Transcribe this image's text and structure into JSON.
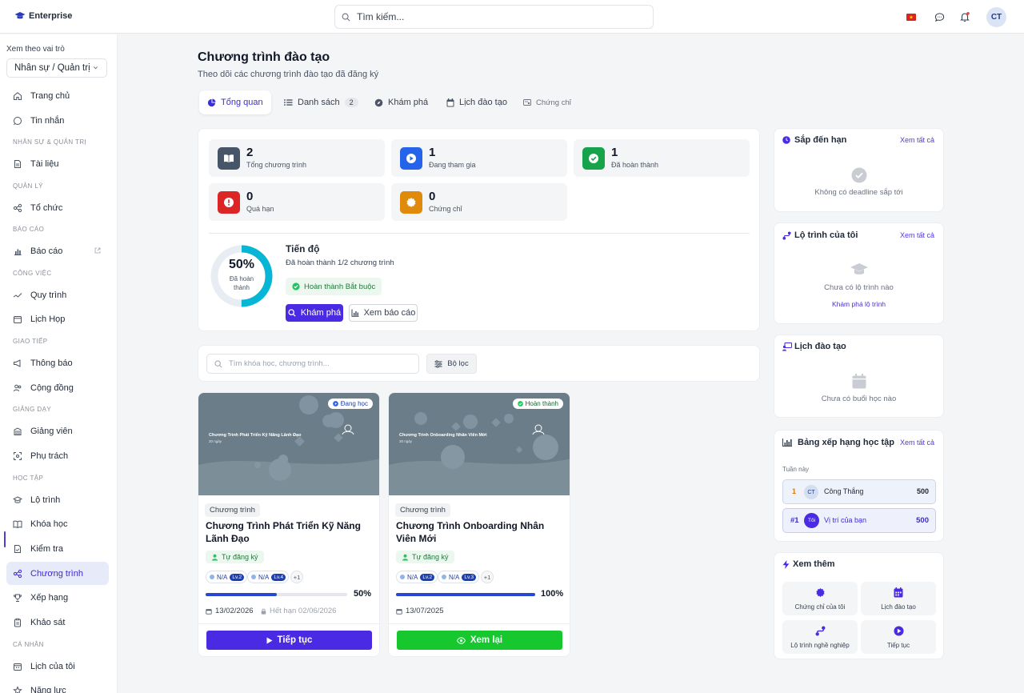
{
  "brand": {
    "name": "Enterprise"
  },
  "header": {
    "search_placeholder": "Tìm kiếm...",
    "avatar_initials": "CT"
  },
  "sidebar": {
    "role_label": "Xem theo vai trò",
    "role_value": "Nhân sự / Quản trị",
    "items": [
      {
        "label": "Trang chủ"
      },
      {
        "label": "Tin nhắn"
      },
      {
        "section": "NHÂN SỰ & QUẢN TRỊ"
      },
      {
        "label": "Tài liệu"
      },
      {
        "section": "QUẢN LÝ"
      },
      {
        "label": "Tổ chức"
      },
      {
        "section": "BÁO CÁO"
      },
      {
        "label": "Báo cáo"
      },
      {
        "section": "CÔNG VIỆC"
      },
      {
        "label": "Quy trình"
      },
      {
        "label": "Lịch Họp"
      },
      {
        "section": "GIAO TIẾP"
      },
      {
        "label": "Thông báo"
      },
      {
        "label": "Cộng đồng"
      },
      {
        "section": "GIẢNG DẠY"
      },
      {
        "label": "Giảng viên"
      },
      {
        "label": "Phụ trách"
      },
      {
        "section": "HỌC TẬP"
      },
      {
        "label": "Lộ trình"
      },
      {
        "label": "Khóa học"
      },
      {
        "label": "Kiểm tra"
      },
      {
        "label": "Chương trình"
      },
      {
        "label": "Xếp hạng"
      },
      {
        "label": "Khảo sát"
      },
      {
        "section": "CÁ NHÂN"
      },
      {
        "label": "Lịch của tôi"
      },
      {
        "label": "Năng lực"
      }
    ]
  },
  "page": {
    "title": "Chương trình đào tạo",
    "subtitle": "Theo dõi các chương trình đào tạo đã đăng ký"
  },
  "tabs": [
    {
      "label": "Tổng quan"
    },
    {
      "label": "Danh sách",
      "badge": "2"
    },
    {
      "label": "Khám phá"
    },
    {
      "label": "Lịch đào tạo"
    },
    {
      "label": "Chứng chỉ"
    }
  ],
  "stats": [
    {
      "value": "2",
      "label": "Tổng chương trình",
      "color": "#475569"
    },
    {
      "value": "1",
      "label": "Đang tham gia",
      "color": "#2563eb"
    },
    {
      "value": "1",
      "label": "Đã hoàn thành",
      "color": "#16a34a"
    },
    {
      "value": "0",
      "label": "Quá hạn",
      "color": "#dc2626"
    },
    {
      "value": "0",
      "label": "Chứng chỉ",
      "color": "#e08a0b"
    }
  ],
  "progress": {
    "percent_text": "50%",
    "percent": 50,
    "ring_label": "Đã hoàn thành",
    "title": "Tiến độ",
    "desc": "Đã hoàn thành 1/2 chương trình",
    "badge": "Hoàn thành Bắt buộc",
    "explore_btn": "Khám phá",
    "report_btn": "Xem báo cáo"
  },
  "filter": {
    "search_placeholder": "Tìm khóa học, chương trình...",
    "filter_btn": "Bộ lọc"
  },
  "courses": [
    {
      "status": "Đang học",
      "thumb_title": "Chương Trình Phát Triển Kỹ Năng Lãnh Đạo",
      "thumb_sub": "30 ngày",
      "category": "Chương trình",
      "name": "Chương Trình Phát Triển Kỹ Năng Lãnh Đạo",
      "registration": "Tự đăng ký",
      "levels": [
        {
          "name": "N/A",
          "lv": "Lv.2"
        },
        {
          "name": "N/A",
          "lv": "Lv.4"
        }
      ],
      "more": "+1",
      "progress": 50,
      "progress_text": "50%",
      "date": "13/02/2026",
      "deadline": "Hết hạn 02/06/2026",
      "action": "Tiếp tục",
      "action_color": "#4a2be3"
    },
    {
      "status": "Hoàn thành",
      "thumb_title": "Chương Trình Onboarding Nhân Viên Mới",
      "thumb_sub": "30 ngày",
      "category": "Chương trình",
      "name": "Chương Trình Onboarding Nhân Viên Mới",
      "registration": "Tự đăng ký",
      "levels": [
        {
          "name": "N/A",
          "lv": "Lv.2"
        },
        {
          "name": "N/A",
          "lv": "Lv.3"
        }
      ],
      "more": "+1",
      "progress": 100,
      "progress_text": "100%",
      "date": "13/07/2025",
      "action": "Xem lại",
      "action_color": "#16c72e"
    }
  ],
  "right": {
    "deadline": {
      "title": "Sắp đến hạn",
      "link": "Xem tất cả",
      "empty": "Không có deadline sắp tới"
    },
    "path": {
      "title": "Lộ trình của tôi",
      "link": "Xem tất cả",
      "empty": "Chưa có lộ trình nào",
      "cta": "Khám phá lộ trình"
    },
    "schedule": {
      "title": "Lịch đào tạo",
      "empty": "Chưa có buổi học nào"
    },
    "leaderboard": {
      "title": "Bảng xếp hạng học tập",
      "link": "Xem tất cả",
      "period": "Tuần này",
      "rows": [
        {
          "rank": "1",
          "initials": "CT",
          "name": "Công Thắng",
          "score": "500"
        },
        {
          "rank": "#1",
          "initials": "Tôi",
          "name": "Vị trí của bạn",
          "score": "500"
        }
      ]
    },
    "more": {
      "title": "Xem thêm",
      "items": [
        {
          "label": "Chứng chỉ của tôi"
        },
        {
          "label": "Lịch đào tạo"
        },
        {
          "label": "Lộ trình nghề nghiệp"
        },
        {
          "label": "Tiếp tục"
        }
      ]
    }
  }
}
